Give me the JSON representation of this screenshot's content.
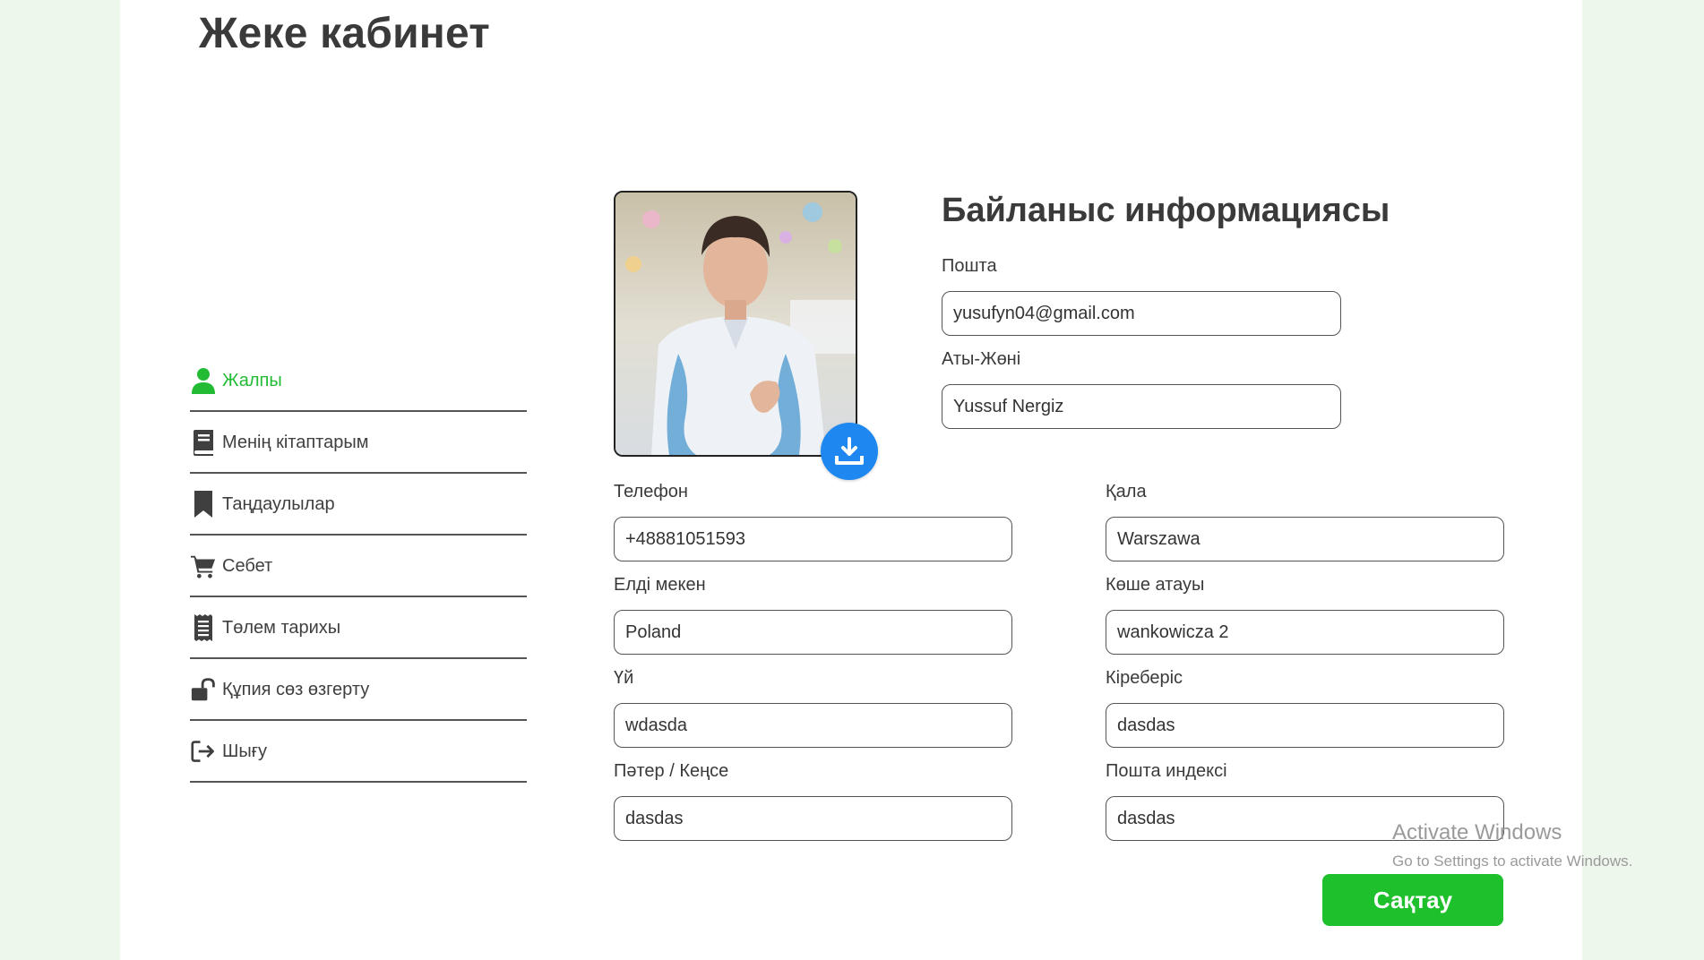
{
  "page_title": "Жеке кабинет",
  "sidebar": {
    "items": [
      {
        "label": "Жалпы",
        "icon": "user-icon",
        "active": true
      },
      {
        "label": "Менің кітаптарым",
        "icon": "book-icon",
        "active": false
      },
      {
        "label": "Таңдаулылар",
        "icon": "bookmark-icon",
        "active": false
      },
      {
        "label": "Себет",
        "icon": "cart-icon",
        "active": false
      },
      {
        "label": "Төлем тарихы",
        "icon": "receipt-icon",
        "active": false
      },
      {
        "label": "Құпия сөз өзгерту",
        "icon": "unlock-icon",
        "active": false
      },
      {
        "label": "Шығу",
        "icon": "logout-icon",
        "active": false
      }
    ],
    "active_color": "#22bb33"
  },
  "avatar": {
    "upload_icon": "upload-icon",
    "upload_color": "#1e88f0"
  },
  "contact": {
    "title": "Байланыс информациясы",
    "email_label": "Пошта",
    "email_value": "yusufyn04@gmail.com",
    "name_label": "Аты-Жөні",
    "name_value": "Yussuf Nergiz",
    "phone_label": "Телефон",
    "phone_value": "+48881051593",
    "city_label": "Қала",
    "city_value": "Warszawa",
    "country_label": "Елді мекен",
    "country_value": "Poland",
    "street_label": "Көше атауы",
    "street_value": "wankowicza 2",
    "house_label": "Үй",
    "house_value": "wdasda",
    "entrance_label": "Кіреберіс",
    "entrance_value": "dasdas",
    "apartment_label": "Пәтер / Кеңсе",
    "apartment_value": "dasdas",
    "postal_label": "Пошта индексі",
    "postal_value": "dasdas"
  },
  "save_button": {
    "label": "Сақтау",
    "color": "#1ec02c"
  },
  "watermark": {
    "line1": "Activate Windows",
    "line2": "Go to Settings to activate Windows."
  }
}
